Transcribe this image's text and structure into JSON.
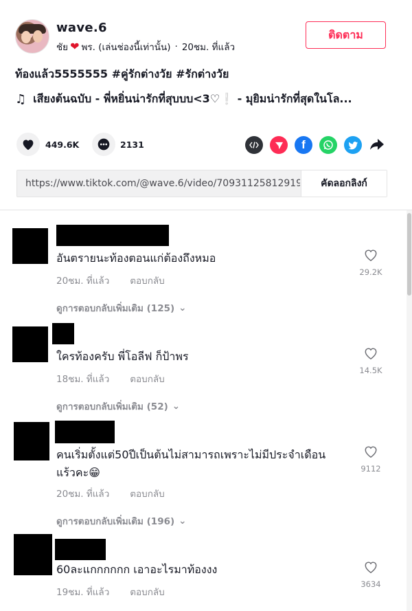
{
  "header": {
    "username": "wave.6",
    "nickname_prefix": "ชัย",
    "nickname_suffix": "พร. (เล่นช่องนี้เท่านั้น)",
    "separator": "·",
    "time_ago": "20ชม. ที่แล้ว",
    "follow_label": "ติดตาม"
  },
  "post": {
    "caption": "ท้องแล้ว5555555 #คู่รักต่างวัย #รักต่างวัย",
    "music": "เสียงต้นฉบับ - พี่หยิ่นน่ารักที่สุบบบ<3♡❕ - มุยิมน่ารักที่สุดในโล..."
  },
  "actions": {
    "likes": "449.6K",
    "comments": "2131"
  },
  "share": {
    "icons": [
      "embed-icon",
      "send-icon",
      "facebook-icon",
      "whatsapp-icon",
      "twitter-icon",
      "share-arrow-icon"
    ],
    "colors": {
      "embed": "#2f3238",
      "send": "#fe2c55",
      "facebook": "#1877f2",
      "whatsapp": "#25d366",
      "twitter": "#1da1f2"
    }
  },
  "link": {
    "url": "https://www.tiktok.com/@wave.6/video/70931125812919...",
    "copy_label": "คัดลอกลิงก์"
  },
  "comments": [
    {
      "text": "อันตรายนะท้องตอนแก่ต้องถึงหมอ",
      "time": "20ชม. ที่แล้ว",
      "reply": "ตอบกลับ",
      "likes": "29.2K",
      "more": "ดูการตอบกลับเพิ่มเติม (125)"
    },
    {
      "text": "ใครท้องครับ พี่โอลีฟ ก็ป้าพร",
      "time": "18ชม. ที่แล้ว",
      "reply": "ตอบกลับ",
      "likes": "14.5K",
      "more": "ดูการตอบกลับเพิ่มเติม (52)"
    },
    {
      "text": "คนเริ่มตั้งแต่50ปีเป็นต้นไม่สามารถเพราะไม่มีประจำเดือนแร้วคะ😁",
      "time": "20ชม. ที่แล้ว",
      "reply": "ตอบกลับ",
      "likes": "9112",
      "more": "ดูการตอบกลับเพิ่มเติม (196)"
    },
    {
      "text": "60ละแกกกกกก เอาอะไรมาท้องงง",
      "time": "19ชม. ที่แล้ว",
      "reply": "ตอบกลับ",
      "likes": "3634"
    }
  ]
}
